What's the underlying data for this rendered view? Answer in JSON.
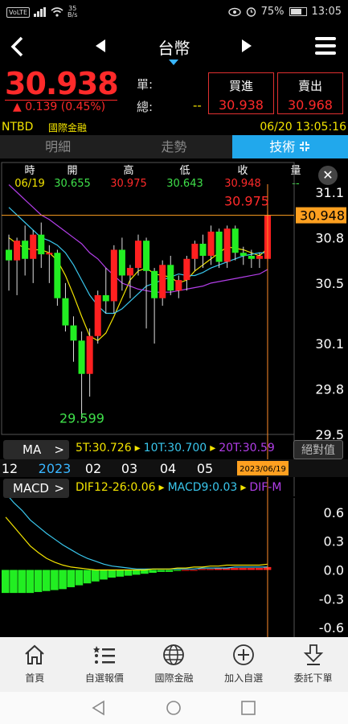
{
  "status": {
    "network": "VoLTE",
    "speed": "35",
    "speed_unit": "B/s",
    "battery": "75%",
    "battery_level": 0.75,
    "clock": "13:05"
  },
  "nav": {
    "title": "台幣"
  },
  "quote": {
    "price": "30.938",
    "change": "▲ 0.139 (0.45%)",
    "unit_label": "單:",
    "total_label": "總:",
    "total_value": "--",
    "bid_label": "買進",
    "bid_value": "30.938",
    "ask_label": "賣出",
    "ask_value": "30.968",
    "ticker": "NTBD",
    "market": "國際金融",
    "datetime": "06/20 13:05:16"
  },
  "tabs": [
    "明細",
    "走勢",
    "技術"
  ],
  "ohlc": {
    "headers": [
      "時",
      "開",
      "高",
      "低",
      "收",
      "量"
    ],
    "values": [
      "06/19",
      "30.655",
      "30.975",
      "30.643",
      "30.948",
      "--"
    ]
  },
  "chart_data": {
    "type": "candlestick",
    "y_ticks": [
      "31.1",
      "30.8",
      "30.5",
      "30.1",
      "29.8",
      "29.5"
    ],
    "ylim": [
      29.5,
      31.1
    ],
    "high_label": "30.975",
    "low_label": "29.599",
    "cursor_price": "30.948",
    "candles": [
      {
        "o": 30.72,
        "h": 30.82,
        "l": 30.45,
        "c": 30.65
      },
      {
        "o": 30.65,
        "h": 30.8,
        "l": 30.42,
        "c": 30.78
      },
      {
        "o": 30.78,
        "h": 30.88,
        "l": 30.55,
        "c": 30.66
      },
      {
        "o": 30.66,
        "h": 30.85,
        "l": 30.5,
        "c": 30.82
      },
      {
        "o": 30.82,
        "h": 30.9,
        "l": 30.6,
        "c": 30.69
      },
      {
        "o": 30.69,
        "h": 30.75,
        "l": 30.5,
        "c": 30.7
      },
      {
        "o": 30.7,
        "h": 30.72,
        "l": 30.35,
        "c": 30.4
      },
      {
        "o": 30.4,
        "h": 30.5,
        "l": 30.18,
        "c": 30.22
      },
      {
        "o": 30.22,
        "h": 30.28,
        "l": 29.98,
        "c": 30.12
      },
      {
        "o": 30.12,
        "h": 30.18,
        "l": 29.6,
        "c": 29.9
      },
      {
        "o": 29.9,
        "h": 30.2,
        "l": 29.75,
        "c": 30.15
      },
      {
        "o": 30.15,
        "h": 30.45,
        "l": 30.1,
        "c": 30.42
      },
      {
        "o": 30.42,
        "h": 30.6,
        "l": 30.3,
        "c": 30.38
      },
      {
        "o": 30.38,
        "h": 30.75,
        "l": 30.3,
        "c": 30.72
      },
      {
        "o": 30.72,
        "h": 30.8,
        "l": 30.45,
        "c": 30.55
      },
      {
        "o": 30.55,
        "h": 30.62,
        "l": 30.4,
        "c": 30.6
      },
      {
        "o": 30.6,
        "h": 30.82,
        "l": 30.55,
        "c": 30.78
      },
      {
        "o": 30.78,
        "h": 30.8,
        "l": 30.2,
        "c": 30.58
      },
      {
        "o": 30.58,
        "h": 30.6,
        "l": 30.1,
        "c": 30.4
      },
      {
        "o": 30.4,
        "h": 30.65,
        "l": 30.35,
        "c": 30.62
      },
      {
        "o": 30.62,
        "h": 30.68,
        "l": 30.42,
        "c": 30.45
      },
      {
        "o": 30.45,
        "h": 30.55,
        "l": 30.4,
        "c": 30.52
      },
      {
        "o": 30.52,
        "h": 30.68,
        "l": 30.45,
        "c": 30.66
      },
      {
        "o": 30.66,
        "h": 30.78,
        "l": 30.58,
        "c": 30.76
      },
      {
        "o": 30.76,
        "h": 30.82,
        "l": 30.6,
        "c": 30.68
      },
      {
        "o": 30.68,
        "h": 30.88,
        "l": 30.62,
        "c": 30.84
      },
      {
        "o": 30.84,
        "h": 30.86,
        "l": 30.6,
        "c": 30.64
      },
      {
        "o": 30.64,
        "h": 30.88,
        "l": 30.6,
        "c": 30.86
      },
      {
        "o": 30.86,
        "h": 30.88,
        "l": 30.65,
        "c": 30.7
      },
      {
        "o": 30.7,
        "h": 30.74,
        "l": 30.62,
        "c": 30.68
      },
      {
        "o": 30.68,
        "h": 30.72,
        "l": 30.6,
        "c": 30.66
      },
      {
        "o": 30.66,
        "h": 30.7,
        "l": 30.6,
        "c": 30.68
      },
      {
        "o": 30.66,
        "h": 30.975,
        "l": 30.643,
        "c": 30.948
      }
    ],
    "ma": [
      {
        "name": "5T",
        "color": "#f3e400",
        "values": [
          30.8,
          30.76,
          30.73,
          30.72,
          30.72,
          30.7,
          30.65,
          30.55,
          30.42,
          30.28,
          30.15,
          30.12,
          30.17,
          30.28,
          30.4,
          30.52,
          30.58,
          30.6,
          30.56,
          30.55,
          30.54,
          30.5,
          30.52,
          30.58,
          30.62,
          30.66,
          30.7,
          30.74,
          30.73,
          30.72,
          30.7,
          30.68,
          30.73
        ]
      },
      {
        "name": "10T",
        "color": "#39c6ec",
        "values": [
          31.0,
          30.95,
          30.9,
          30.85,
          30.8,
          30.78,
          30.75,
          30.7,
          30.62,
          30.52,
          30.42,
          30.35,
          30.3,
          30.3,
          30.33,
          30.38,
          30.43,
          30.48,
          30.5,
          30.52,
          30.54,
          30.56,
          30.55,
          30.55,
          30.57,
          30.6,
          30.62,
          30.64,
          30.66,
          30.68,
          30.69,
          30.7,
          30.7
        ]
      },
      {
        "name": "20T",
        "color": "#b23ee8",
        "values": [
          31.15,
          31.1,
          31.05,
          31.0,
          30.95,
          30.92,
          30.88,
          30.84,
          30.8,
          30.76,
          30.7,
          30.66,
          30.6,
          30.55,
          30.5,
          30.48,
          30.46,
          30.45,
          30.44,
          30.44,
          30.44,
          30.45,
          30.46,
          30.47,
          30.48,
          30.5,
          30.51,
          30.52,
          30.53,
          30.54,
          30.55,
          30.56,
          30.59
        ]
      }
    ],
    "x_ticks": [
      "12",
      "2023",
      "02",
      "03",
      "04",
      "05"
    ],
    "cursor_date": "2023/06/19",
    "macd": {
      "y_ticks": [
        "0.6",
        "0.3",
        "0.0",
        "-0.3",
        "-0.6"
      ],
      "ylim": [
        -0.7,
        0.75
      ],
      "hist": [
        -0.24,
        -0.24,
        -0.24,
        -0.24,
        -0.23,
        -0.22,
        -0.21,
        -0.2,
        -0.18,
        -0.16,
        -0.14,
        -0.12,
        -0.1,
        -0.08,
        -0.07,
        -0.06,
        -0.05,
        -0.04,
        -0.03,
        -0.02,
        -0.02,
        -0.01,
        0.0,
        0.0,
        0.01,
        0.01,
        0.02,
        0.02,
        0.02,
        0.02,
        0.02,
        0.02,
        0.03
      ],
      "dif": [
        0.55,
        0.45,
        0.35,
        0.25,
        0.18,
        0.12,
        0.08,
        0.05,
        0.03,
        0.02,
        0.01,
        0.0,
        0.0,
        0.0,
        0.0,
        0.0,
        0.0,
        0.0,
        0.01,
        0.01,
        0.01,
        0.02,
        0.02,
        0.03,
        0.03,
        0.04,
        0.04,
        0.05,
        0.05,
        0.05,
        0.05,
        0.05,
        0.06
      ],
      "signal": [
        0.8,
        0.7,
        0.62,
        0.52,
        0.45,
        0.38,
        0.32,
        0.26,
        0.21,
        0.16,
        0.12,
        0.09,
        0.06,
        0.04,
        0.03,
        0.02,
        0.01,
        0.01,
        0.01,
        0.01,
        0.01,
        0.01,
        0.01,
        0.01,
        0.02,
        0.02,
        0.02,
        0.02,
        0.03,
        0.03,
        0.03,
        0.03,
        0.03
      ]
    }
  },
  "ma_bar": {
    "label": "MA",
    "arrow": ">",
    "items": [
      "5T:30.726",
      "10T:30.700",
      "20T:30.59"
    ],
    "colors": [
      "#f3e400",
      "#39c6ec",
      "#b23ee8"
    ],
    "absolute_label": "絕對值"
  },
  "macd_bar": {
    "label": "MACD",
    "arrow": ">",
    "items": [
      "DIF12-26:0.06",
      "MACD9:0.03",
      "DIF-M"
    ],
    "colors": [
      "#f3e400",
      "#39c6ec",
      "#b23ee8"
    ]
  },
  "bottom_nav": [
    {
      "label": "首頁",
      "icon": "home-icon"
    },
    {
      "label": "自選報價",
      "icon": "watchlist-icon"
    },
    {
      "label": "國際金融",
      "icon": "globe-icon"
    },
    {
      "label": "加入自選",
      "icon": "add-icon"
    },
    {
      "label": "委託下單",
      "icon": "order-icon"
    }
  ]
}
